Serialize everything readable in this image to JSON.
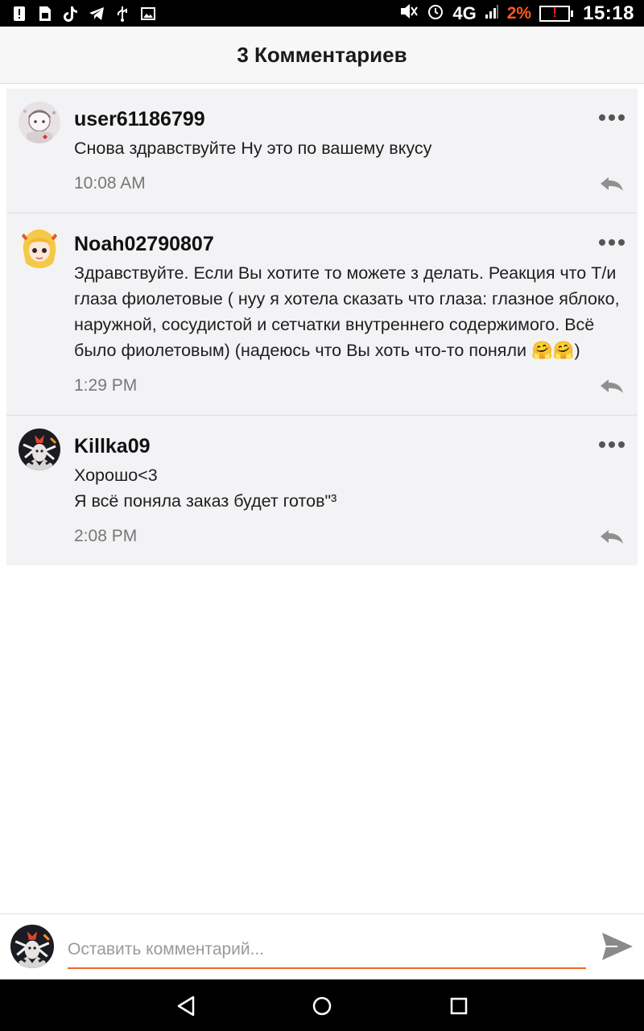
{
  "status_bar": {
    "network": "4G",
    "battery_percent": "2%",
    "time": "15:18",
    "icons": [
      "alert-icon",
      "sim-icon",
      "tiktok-icon",
      "telegram-icon",
      "usb-icon",
      "image-icon",
      "mute-icon",
      "alarm-icon",
      "signal-icon",
      "battery-icon"
    ]
  },
  "header": {
    "title": "3 Комментариев"
  },
  "comments": [
    {
      "username": "user61186799",
      "text": "Снова здравствуйте Ну это по вашему вкусу",
      "time": "10:08 AM"
    },
    {
      "username": "Noah02790807",
      "text": "Здравствуйте. Если Вы хотите то можете з делать. Реакция что Т/и глаза фиолетовые ( нуу я хотела сказать что глаза:  глазное яблоко, наружной, сосудистой и сетчатки внутреннего содержимого. Всё было фиолетовым) (надеюсь что Вы хоть что-то поняли 🤗🤗)",
      "time": "1:29 PM"
    },
    {
      "username": "Killka09",
      "text": "Хорошо<3\nЯ всё поняла заказ будет готов\"³",
      "time": "2:08 PM"
    }
  ],
  "input": {
    "placeholder": "Оставить комментарий..."
  },
  "colors": {
    "accent": "#ee6a2a",
    "battery_warning": "#ff5a1f",
    "card_bg": "#f3f3f5"
  }
}
